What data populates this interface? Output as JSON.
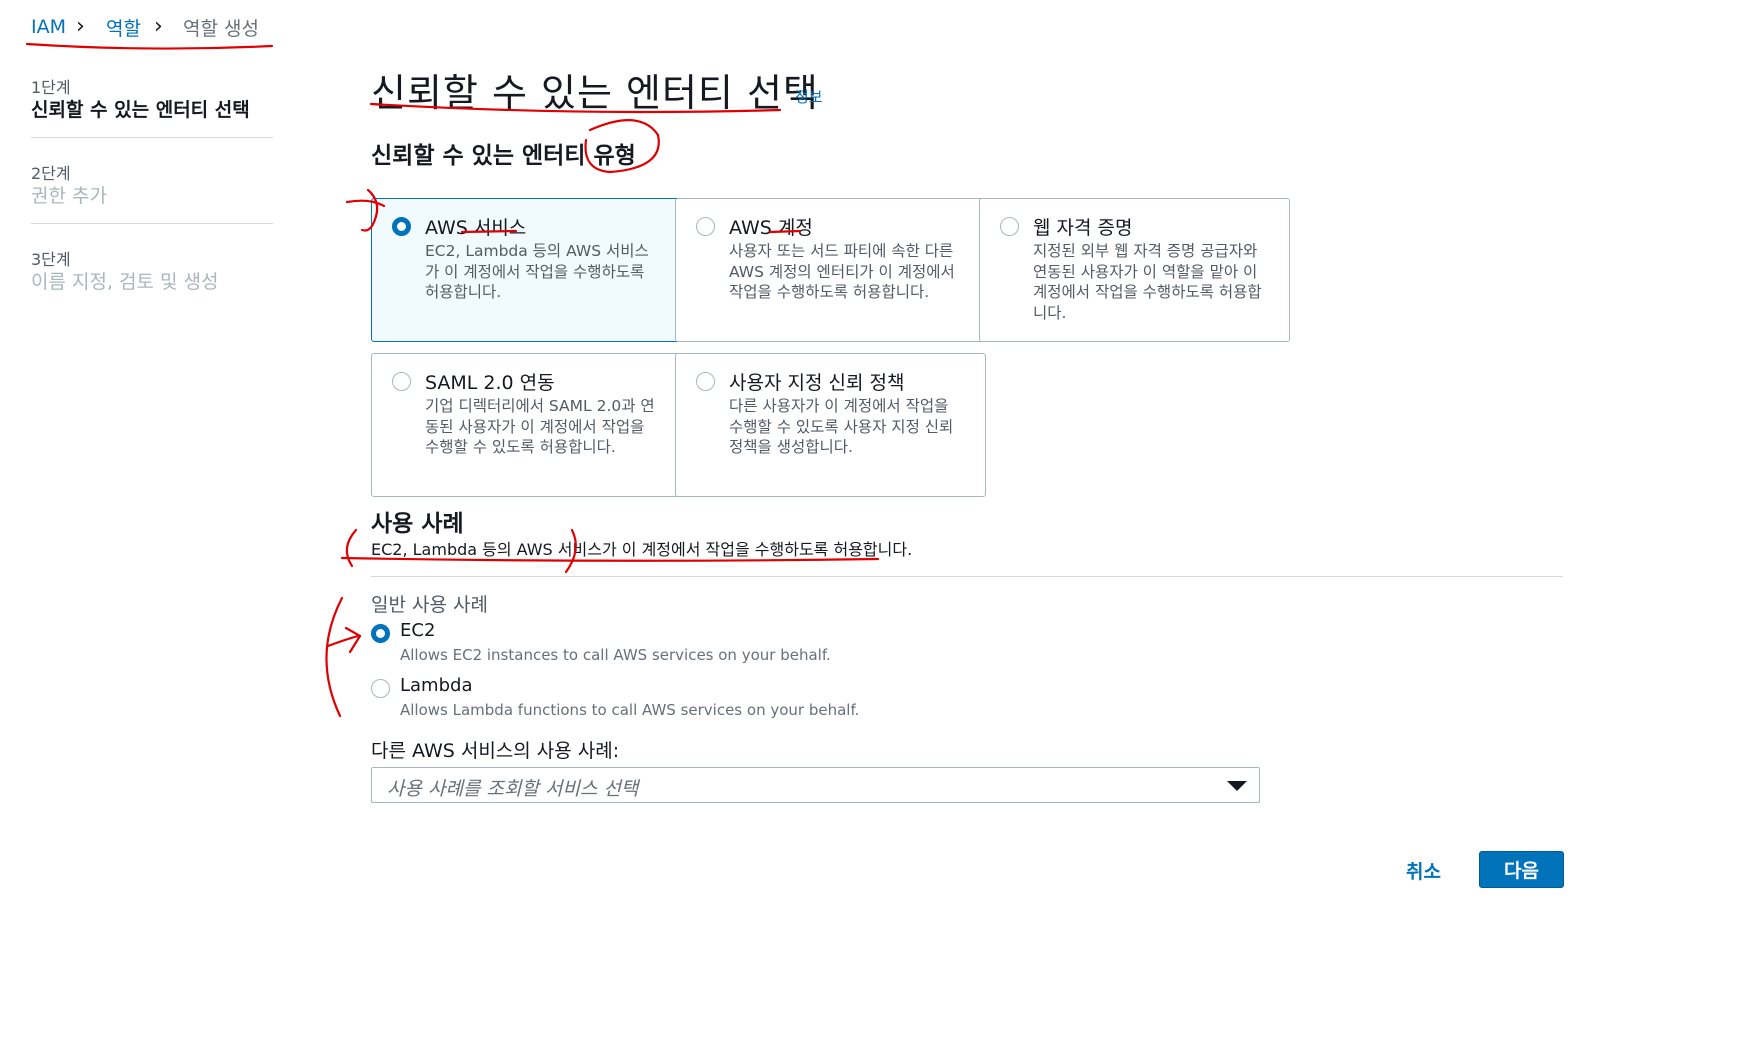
{
  "breadcrumb": {
    "items": [
      {
        "label": "IAM"
      },
      {
        "label": "역할"
      },
      {
        "label": "역할 생성"
      }
    ]
  },
  "steps": [
    {
      "number": "1단계",
      "title": "신뢰할 수 있는 엔터티 선택",
      "state": "active"
    },
    {
      "number": "2단계",
      "title": "권한 추가",
      "state": "inactive"
    },
    {
      "number": "3단계",
      "title": "이름 지정, 검토 및 생성",
      "state": "inactive"
    }
  ],
  "page": {
    "title": "신뢰할 수 있는 엔터티 선택",
    "info_link": "정보"
  },
  "entity_type": {
    "heading": "신뢰할 수 있는 엔터티 유형",
    "options": [
      {
        "title": "AWS 서비스",
        "description": "EC2, Lambda 등의 AWS 서비스가 이 계정에서 작업을 수행하도록 허용합니다.",
        "selected": true
      },
      {
        "title": "AWS 계정",
        "description": "사용자 또는 서드 파티에 속한 다른 AWS 계정의 엔터티가 이 계정에서 작업을 수행하도록 허용합니다.",
        "selected": false
      },
      {
        "title": "웹 자격 증명",
        "description": "지정된 외부 웹 자격 증명 공급자와 연동된 사용자가 이 역할을 맡아 이 계정에서 작업을 수행하도록 허용합니다.",
        "selected": false
      },
      {
        "title": "SAML 2.0 연동",
        "description": "기업 디렉터리에서 SAML 2.0과 연동된 사용자가 이 계정에서 작업을 수행할 수 있도록 허용합니다.",
        "selected": false
      },
      {
        "title": "사용자 지정 신뢰 정책",
        "description": "다른 사용자가 이 계정에서 작업을 수행할 수 있도록 사용자 지정 신뢰 정책을 생성합니다.",
        "selected": false
      }
    ]
  },
  "use_case": {
    "heading": "사용 사례",
    "description": "EC2, Lambda 등의 AWS 서비스가 이 계정에서 작업을 수행하도록 허용합니다.",
    "common_label": "일반 사용 사례",
    "options": [
      {
        "title": "EC2",
        "description": "Allows EC2 instances to call AWS services on your behalf.",
        "selected": true
      },
      {
        "title": "Lambda",
        "description": "Allows Lambda functions to call AWS services on your behalf.",
        "selected": false
      }
    ],
    "other_label": "다른 AWS 서비스의 사용 사례:",
    "select_placeholder": "사용 사례를 조회할 서비스 선택"
  },
  "footer": {
    "cancel_label": "취소",
    "next_label": "다음"
  },
  "colors": {
    "accent": "#0073bb",
    "annotation": "#e00000"
  }
}
